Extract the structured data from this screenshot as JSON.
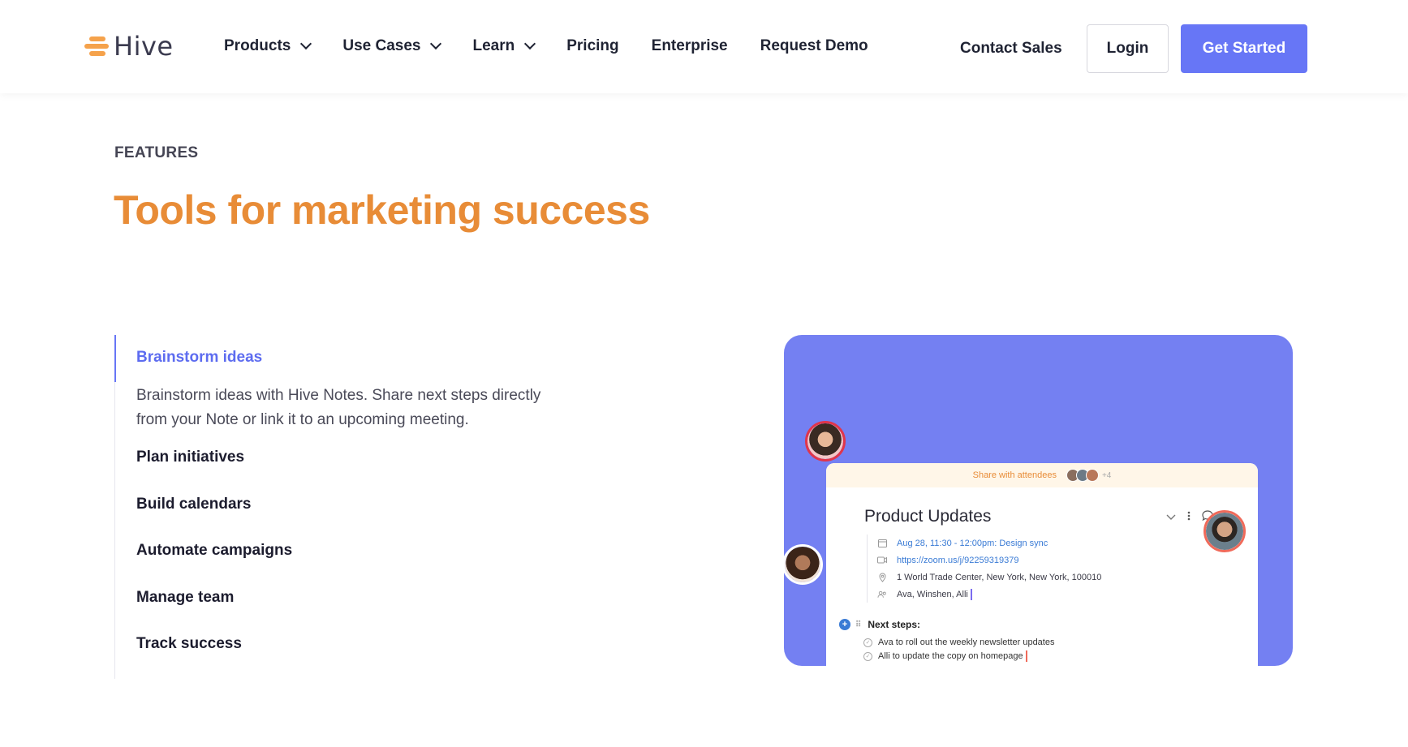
{
  "header": {
    "logo_text": "Hive",
    "nav": [
      {
        "label": "Products",
        "dropdown": true
      },
      {
        "label": "Use Cases",
        "dropdown": true
      },
      {
        "label": "Learn",
        "dropdown": true
      },
      {
        "label": "Pricing",
        "dropdown": false
      },
      {
        "label": "Enterprise",
        "dropdown": false
      },
      {
        "label": "Request Demo",
        "dropdown": false
      }
    ],
    "contact_label": "Contact Sales",
    "login_label": "Login",
    "cta_label": "Get Started"
  },
  "hero": {
    "eyebrow": "FEATURES",
    "title": "Tools for marketing success"
  },
  "features": {
    "items": [
      {
        "label": "Brainstorm ideas",
        "active": true,
        "description": "Brainstorm ideas with Hive Notes. Share next steps directly from your Note or link it to an upcoming meeting."
      },
      {
        "label": "Plan initiatives",
        "active": false
      },
      {
        "label": "Build calendars",
        "active": false
      },
      {
        "label": "Automate campaigns",
        "active": false
      },
      {
        "label": "Manage team",
        "active": false
      },
      {
        "label": "Track success",
        "active": false
      }
    ]
  },
  "illustration": {
    "share_label": "Share with attendees",
    "share_extra": "+4",
    "note_title": "Product Updates",
    "meta": [
      {
        "icon": "calendar-icon",
        "text": "Aug 28, 11:30 - 12:00pm: Design sync"
      },
      {
        "icon": "video-icon",
        "text": "https://zoom.us/j/92259319379"
      },
      {
        "icon": "location-icon",
        "text": "1 World Trade Center, New York, New York, 100010"
      },
      {
        "icon": "people-icon",
        "text": "Ava, Winshen, Alli"
      }
    ],
    "next_steps_label": "Next steps:",
    "todos": [
      "Ava to roll out the weekly newsletter updates",
      "Alli to update the copy on homepage"
    ]
  },
  "colors": {
    "brand_orange": "#e88c37",
    "accent_blue": "#6776f6",
    "illustration_bg": "#7480f2"
  }
}
